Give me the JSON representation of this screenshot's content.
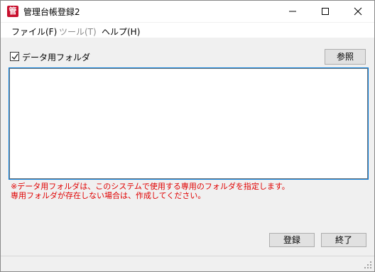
{
  "window": {
    "title": "管理台帳登録2",
    "icon_label": "管"
  },
  "menu": {
    "file": "ファイル(F)",
    "tool": "ツール(T)",
    "help": "ヘルプ(H)"
  },
  "form": {
    "checkbox_label": "データ用フォルダ",
    "checkbox_checked": true,
    "browse_label": "参照",
    "path_value": "",
    "notice_line1": "※データ用フォルダは、このシステムで使用する専用のフォルダを指定します。",
    "notice_line2": "専用フォルダが存在しない場合は、作成してください。"
  },
  "actions": {
    "register_label": "登録",
    "exit_label": "終了"
  },
  "colors": {
    "notice": "#e00000",
    "focus": "#0078d7",
    "icon": "#c8102e"
  }
}
